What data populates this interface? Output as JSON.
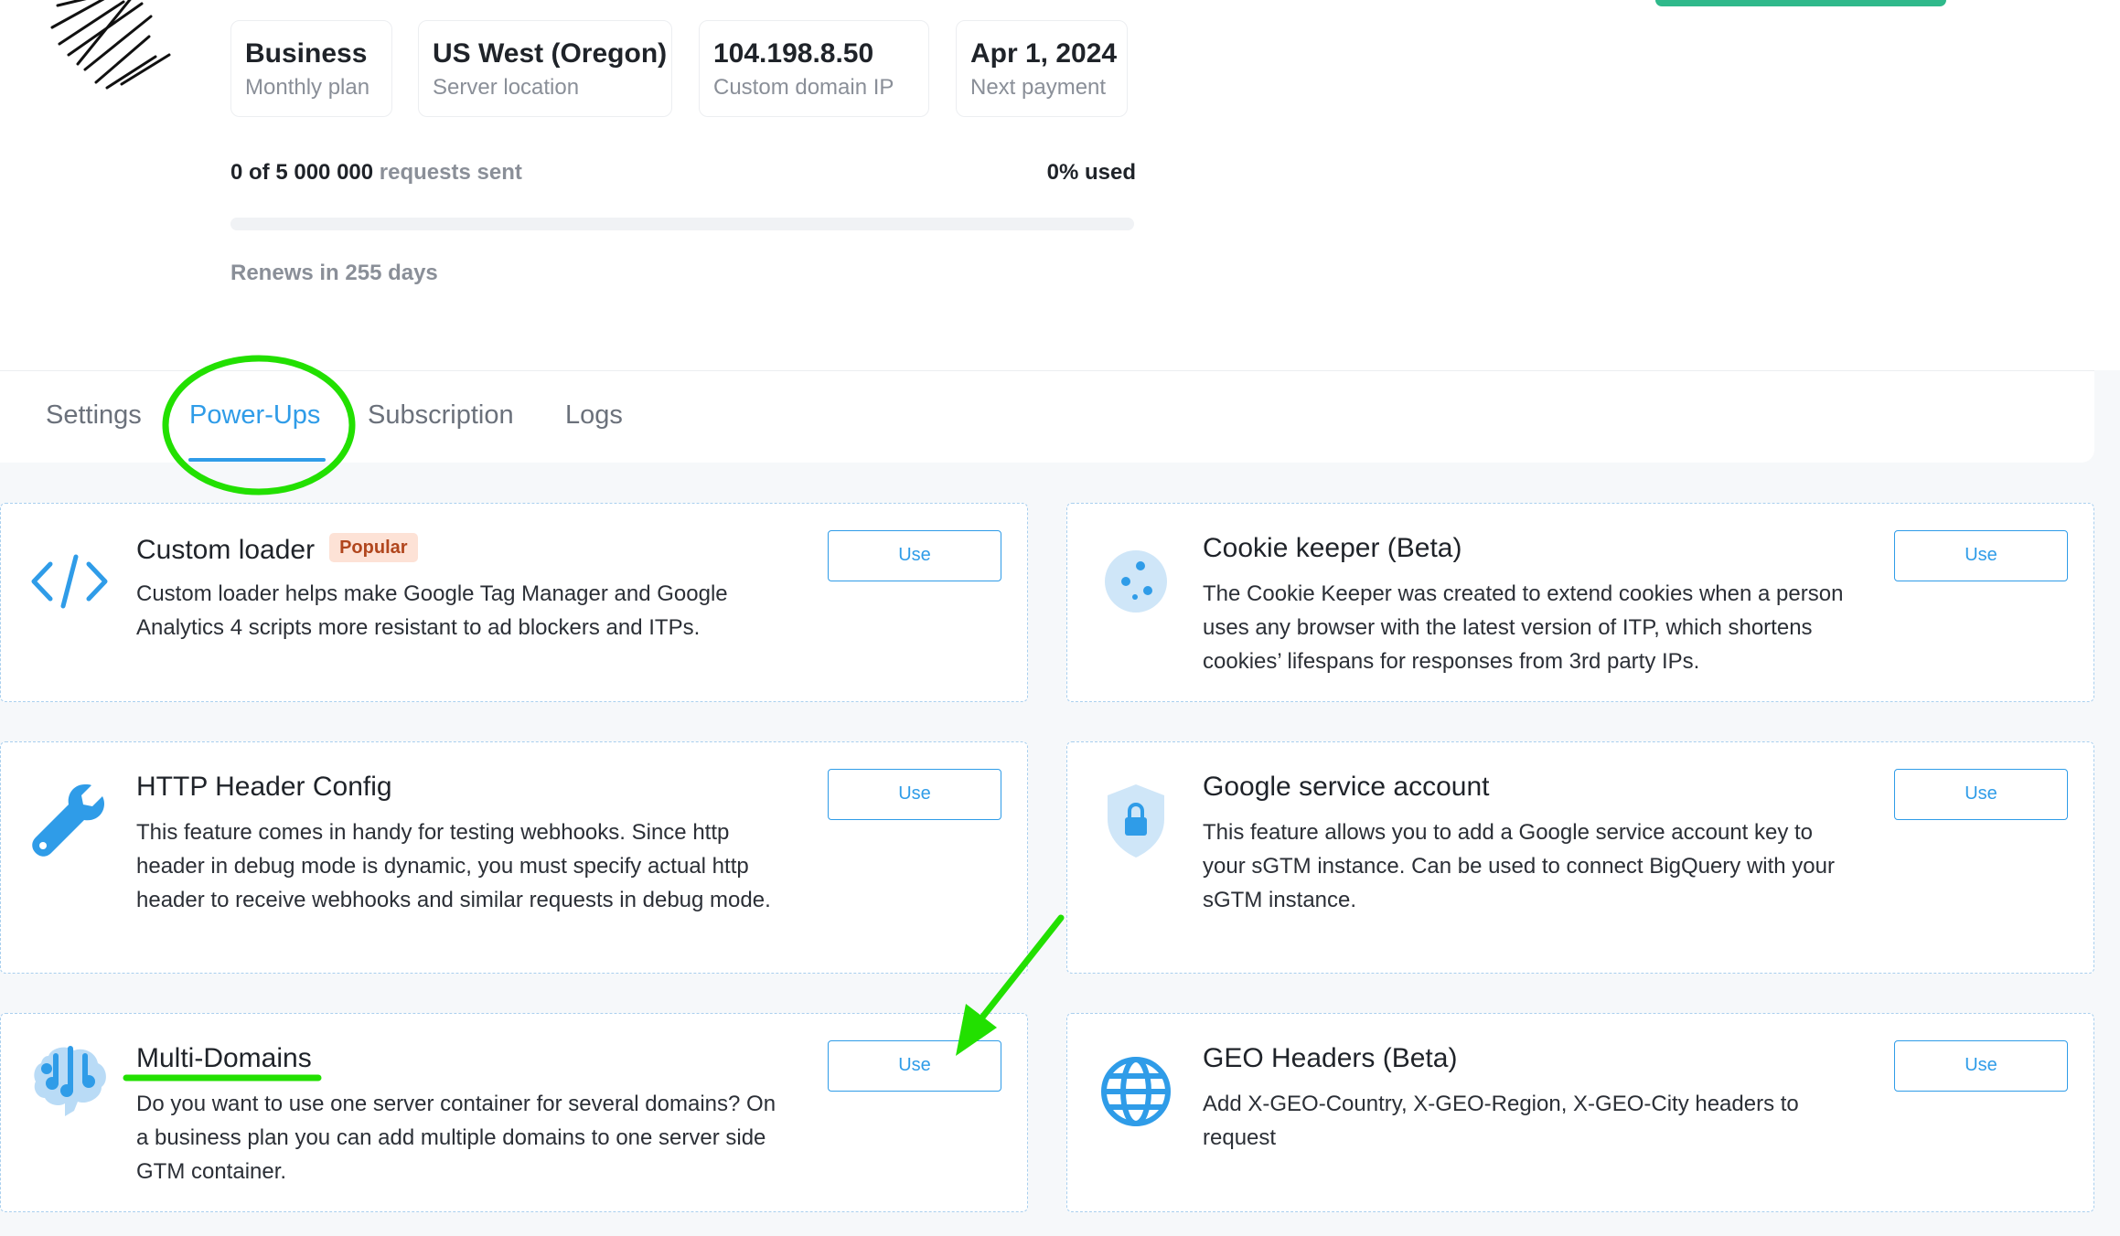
{
  "stats": [
    {
      "value": "Business",
      "label": "Monthly plan"
    },
    {
      "value": "US West (Oregon)",
      "label": "Server location"
    },
    {
      "value": "104.198.8.50",
      "label": "Custom domain IP"
    },
    {
      "value": "Apr 1, 2024",
      "label": "Next payment"
    }
  ],
  "usage": {
    "count": "0 of 5 000 000",
    "suffix": "requests sent",
    "percent": "0% used",
    "fraction_used": 0.0,
    "renews": "Renews in 255 days"
  },
  "tabs": [
    {
      "label": "Settings",
      "active": false
    },
    {
      "label": "Power-Ups",
      "active": true
    },
    {
      "label": "Subscription",
      "active": false
    },
    {
      "label": "Logs",
      "active": false
    }
  ],
  "powerups": [
    {
      "title": "Custom loader",
      "badge": "Popular",
      "icon": "code-icon",
      "button": "Use",
      "description": "Custom loader helps make Google Tag Manager and Google Analytics 4 scripts more resistant to ad blockers and ITPs."
    },
    {
      "title": "Cookie keeper (Beta)",
      "icon": "cookie-icon",
      "button": "Use",
      "description": "The Cookie Keeper was created to extend cookies when a person uses any browser with the latest version of ITP, which shortens cookies’ lifespans for responses from 3rd party IPs."
    },
    {
      "title": "HTTP Header Config",
      "icon": "wrench-icon",
      "button": "Use",
      "description": "This feature comes in handy for testing webhooks. Since http header in debug mode is dynamic, you must specify actual http header to receive webhooks and similar requests in debug mode."
    },
    {
      "title": "Google service account",
      "icon": "shield-lock-icon",
      "button": "Use",
      "description": "This feature allows you to add a Google service account key to your sGTM instance. Can be used to connect BigQuery with your sGTM instance."
    },
    {
      "title": "Multi-Domains",
      "icon": "brain-icon",
      "button": "Use",
      "description": "Do you want to use one server container for several domains? On a business plan you can add multiple domains to one server side GTM container."
    },
    {
      "title": "GEO Headers (Beta)",
      "icon": "globe-icon",
      "button": "Use",
      "description": "Add X-GEO-Country, X-GEO-Region, X-GEO-City headers to request"
    }
  ],
  "colors": {
    "accent": "#2f9ce8",
    "annotation_green": "#22e000",
    "badge_bg": "#fde2d6",
    "badge_text": "#b1461d",
    "success": "#2fb98b"
  }
}
